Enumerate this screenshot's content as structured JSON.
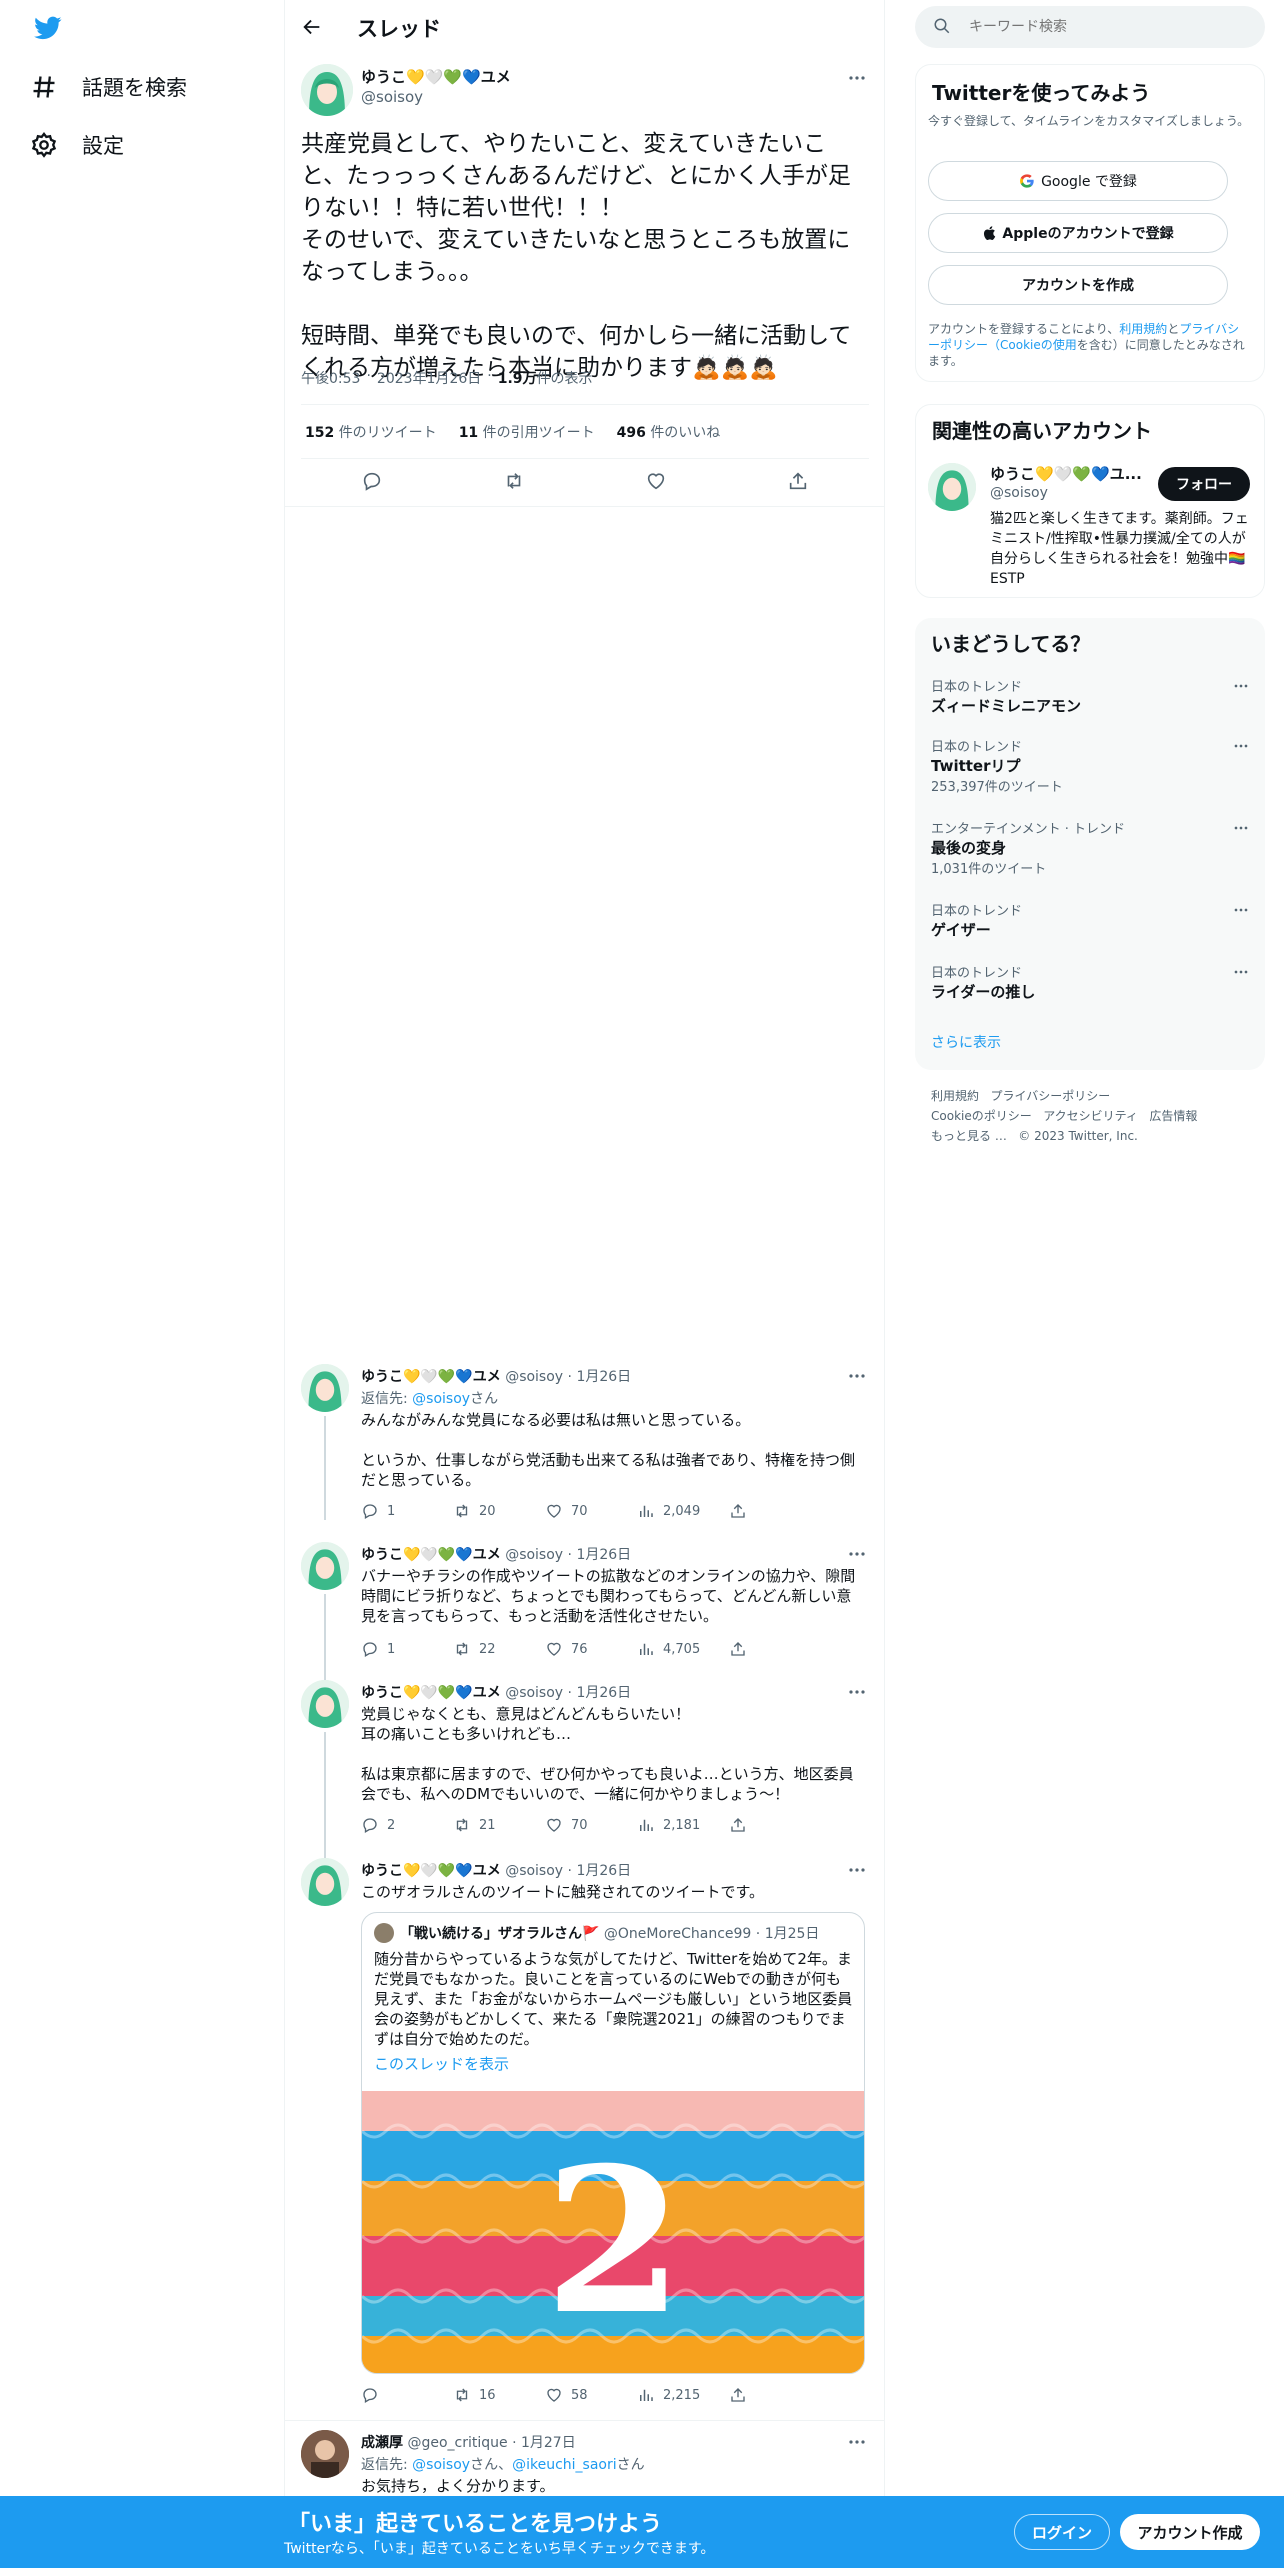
{
  "colors": {
    "accent": "#1d9bf0",
    "text": "#0f1419",
    "muted": "#536471",
    "panel": "#f7f9f9",
    "border": "#eff3f4"
  },
  "nav": {
    "logo_icon": "twitter-bird-icon",
    "items": [
      {
        "icon": "hashtag-icon",
        "label": "話題を検索"
      },
      {
        "icon": "gear-icon",
        "label": "設定"
      }
    ]
  },
  "header": {
    "back_icon": "arrow-left-icon",
    "title": "スレッド"
  },
  "main_tweet": {
    "name": "ゆうこ💛🤍💚💙ユメ",
    "handle": "@soisoy",
    "text": "共産党員として、やりたいこと、変えていきたいこと、たっっっくさんあるんだけど、とにかく人手が足りない！！特に若い世代！！！\nそのせいで、変えていきたいなと思うところも放置になってしまう。。。\n\n短時間、単発でも良いので、何かしら一緒に活動してくれる方が増えたら本当に助かります🙇🏻🙇🏻🙇🏻",
    "time": "午後0:53",
    "date": "2023年1月26日",
    "views_count": "1.9万",
    "views_label": "件の表示",
    "stats": [
      {
        "count": "152",
        "label": "件のリツイート"
      },
      {
        "count": "11",
        "label": "件の引用ツイート"
      },
      {
        "count": "496",
        "label": "件のいいね"
      }
    ]
  },
  "replies": [
    {
      "name": "ゆうこ💛🤍💚💙ユメ",
      "handle": "@soisoy",
      "date": "1月26日",
      "reply_to_prefix": "返信先: ",
      "reply_to": "@soisoy",
      "reply_to_suffix": "さん",
      "text": "みんながみんな党員になる必要は私は無いと思っている。\n\nというか、仕事しながら党活動も出来てる私は強者であり、特権を持つ側だと思っている。",
      "replies": "1",
      "retweets": "20",
      "likes": "70",
      "views": "2,049"
    },
    {
      "name": "ゆうこ💛🤍💚💙ユメ",
      "handle": "@soisoy",
      "date": "1月26日",
      "text": "バナーやチラシの作成やツイートの拡散などのオンラインの協力や、隙間時間にビラ折りなど、ちょっとでも関わってもらって、どんどん新しい意見を言ってもらって、もっと活動を活性化させたい。",
      "replies": "1",
      "retweets": "22",
      "likes": "76",
      "views": "4,705"
    },
    {
      "name": "ゆうこ💛🤍💚💙ユメ",
      "handle": "@soisoy",
      "date": "1月26日",
      "text": "党員じゃなくとも、意見はどんどんもらいたい！\n耳の痛いことも多いけれども…\n\n私は東京都に居ますので、ぜひ何かやっても良いよ…という方、地区委員会でも、私へのDMでもいいので、一緒に何かやりましょう〜！",
      "replies": "2",
      "retweets": "21",
      "likes": "70",
      "views": "2,181"
    },
    {
      "name": "ゆうこ💛🤍💚💙ユメ",
      "handle": "@soisoy",
      "date": "1月26日",
      "text": "このザオラルさんのツイートに触発されてのツイートです。",
      "quote": {
        "name": "「戦い続ける」ザオラルさん🚩",
        "handle": "@OneMoreChance99",
        "date": "1月25日",
        "text": "随分昔からやっているような気がしてたけど、Twitterを始めて2年。まだ党員でもなかった。良いことを言っているのにWebでの動きが何も見えず、また「お金がないからホームページも厳しい」という地区委員会の姿勢がもどかしくて、来たる「衆院選2021」の練習のつもりでまずは自分で始めたのだ。",
        "show_thread": "このスレッドを表示",
        "image_number": "2"
      },
      "replies": "",
      "retweets": "16",
      "likes": "58",
      "views": "2,215"
    },
    {
      "name": "成瀬厚",
      "handle": "@geo_critique",
      "date": "1月27日",
      "reply_to_prefix": "返信先: ",
      "reply_to": "@soisoy",
      "reply_to_mid": "さん、",
      "reply_to_2": "@ikeuchi_saori",
      "reply_to_suffix": "さん",
      "text": "お気持ち，よく分かります。"
    }
  ],
  "search": {
    "placeholder": "キーワード検索"
  },
  "signup": {
    "title": "Twitterを使ってみよう",
    "subtitle": "今すぐ登録して、タイムラインをカスタマイズしましょう。",
    "google_label": "Google で登録",
    "apple_label": "Appleのアカウントで登録",
    "create_label": "アカウントを作成",
    "terms_prefix": "アカウントを登録することにより、",
    "terms_link1": "利用規約",
    "terms_and": "と",
    "terms_link2": "プライバシーポリシー（Cookieの使用",
    "terms_suffix": "を含む）に同意したとみなされます。"
  },
  "related": {
    "title": "関連性の高いアカウント",
    "name": "ゆうこ💛🤍💚💙ユ...",
    "handle": "@soisoy",
    "follow_label": "フォロー",
    "bio": "猫2匹と楽しく生きてます。薬剤師。フェミニスト/性搾取•性暴力撲滅/全ての人が自分らしく生きられる社会を！勉強中🏳️‍🌈ESTP"
  },
  "trends": {
    "title": "いまどうしてる？",
    "items": [
      {
        "category": "日本のトレンド",
        "name": "ズィードミレニアモン",
        "count": ""
      },
      {
        "category": "日本のトレンド",
        "name": "Twitterリプ",
        "count": "253,397件のツイート"
      },
      {
        "category": "エンターテインメント · トレンド",
        "name": "最後の変身",
        "count": "1,031件のツイート"
      },
      {
        "category": "日本のトレンド",
        "name": "ゲイザー",
        "count": ""
      },
      {
        "category": "日本のトレンド",
        "name": "ライダーの推し",
        "count": ""
      }
    ],
    "show_more": "さらに表示"
  },
  "footer": {
    "links": [
      "利用規約",
      "プライバシーポリシー",
      "Cookieのポリシー",
      "アクセシビリティ",
      "広告情報",
      "もっと見る …"
    ],
    "copyright": "© 2023 Twitter, Inc."
  },
  "banner": {
    "title": "「いま」起きていることを見つけよう",
    "subtitle": "Twitterなら、「いま」起きていることをいち早くチェックできます。",
    "login_label": "ログイン",
    "signup_label": "アカウント作成"
  }
}
